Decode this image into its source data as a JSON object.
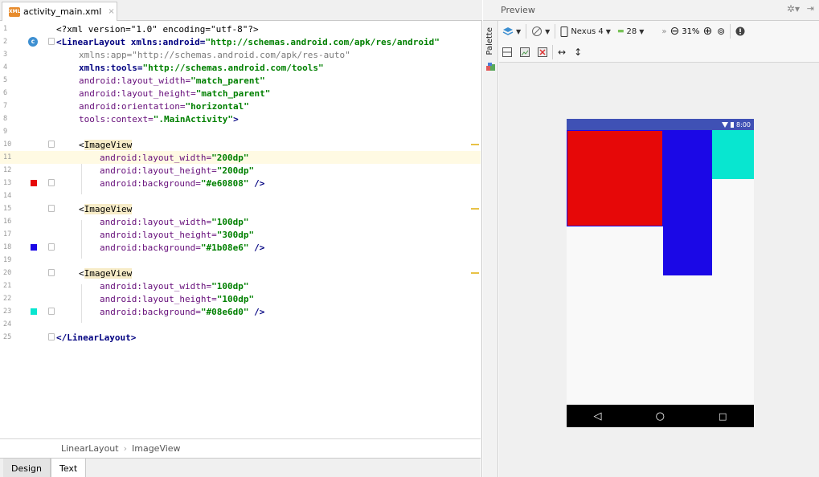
{
  "editor": {
    "tab_label": "activity_main.xml",
    "tab_close": "×",
    "xml_icon_label": "XML",
    "gutter_c_badge": "c"
  },
  "code_lines": [
    {
      "n": "1"
    },
    {
      "n": "2"
    },
    {
      "n": "3"
    },
    {
      "n": "4"
    },
    {
      "n": "5"
    },
    {
      "n": "6"
    },
    {
      "n": "7"
    },
    {
      "n": "8"
    },
    {
      "n": "9"
    },
    {
      "n": "10"
    },
    {
      "n": "11"
    },
    {
      "n": "12"
    },
    {
      "n": "13"
    },
    {
      "n": "14"
    },
    {
      "n": "15"
    },
    {
      "n": "16"
    },
    {
      "n": "17"
    },
    {
      "n": "18"
    },
    {
      "n": "19"
    },
    {
      "n": "20"
    },
    {
      "n": "21"
    },
    {
      "n": "22"
    },
    {
      "n": "23"
    },
    {
      "n": "24"
    },
    {
      "n": "25"
    }
  ],
  "code": {
    "l1": "<?xml version=\"1.0\" encoding=\"utf-8\"?>",
    "l2_tag": "<LinearLayout",
    "l2_attr": " xmlns:android=",
    "l2_val": "\"http://schemas.android.com/apk/res/android\"",
    "l3_attr": "xmlns:app=",
    "l3_val": "\"http://schemas.android.com/apk/res-auto\"",
    "l4_attr": "xmlns:tools=",
    "l4_val": "\"http://schemas.android.com/tools\"",
    "l5_attr": "android:layout_width=",
    "l5_val": "\"match_parent\"",
    "l6_attr": "android:layout_height=",
    "l6_val": "\"match_parent\"",
    "l7_attr": "android:orientation=",
    "l7_val": "\"horizontal\"",
    "l8_attr": "tools:context=",
    "l8_val": "\".MainActivity\"",
    "l8_end": ">",
    "l10_open": "<",
    "l10_tag": "ImageView",
    "l11_attr": "android:layout_width=",
    "l11_val": "\"200dp\"",
    "l12_attr": "android:layout_height=",
    "l12_val": "\"200dp\"",
    "l13_attr": "android:background=",
    "l13_val": "\"#e60808\"",
    "l13_end": " />",
    "l15_open": "<",
    "l15_tag": "ImageView",
    "l16_attr": "android:layout_width=",
    "l16_val": "\"100dp\"",
    "l17_attr": "android:layout_height=",
    "l17_val": "\"300dp\"",
    "l18_attr": "android:background=",
    "l18_val": "\"#1b08e6\"",
    "l18_end": " />",
    "l20_open": "<",
    "l20_tag": "ImageView",
    "l21_attr": "android:layout_width=",
    "l21_val": "\"100dp\"",
    "l22_attr": "android:layout_height=",
    "l22_val": "\"100dp\"",
    "l23_attr": "android:background=",
    "l23_val": "\"#08e6d0\"",
    "l23_end": " />",
    "l25": "</LinearLayout>"
  },
  "swatches": {
    "red": "#e60808",
    "blue": "#1b08e6",
    "cyan": "#08e6d0"
  },
  "breadcrumb": {
    "root": "LinearLayout",
    "sep": "›",
    "child": "ImageView"
  },
  "bottom_tabs": {
    "design": "Design",
    "text": "Text"
  },
  "palette": {
    "label": "Palette"
  },
  "preview": {
    "title": "Preview",
    "device": "Nexus 4",
    "api": "28",
    "zoom": "31%",
    "time": "8:00"
  }
}
